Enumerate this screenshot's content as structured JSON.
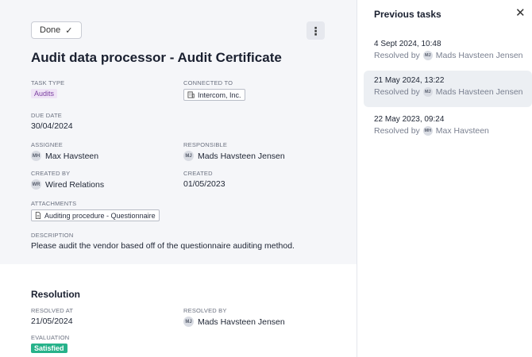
{
  "task": {
    "done_label": "Done",
    "title": "Audit data processor - Audit Certificate",
    "fields": {
      "task_type": {
        "label": "TASK TYPE",
        "value": "Audits"
      },
      "connected_to": {
        "label": "CONNECTED TO",
        "value": "Intercom, Inc."
      },
      "due_date": {
        "label": "DUE DATE",
        "value": "30/04/2024"
      },
      "assignee": {
        "label": "ASSIGNEE",
        "initials": "MH",
        "value": "Max Havsteen"
      },
      "responsible": {
        "label": "RESPONSIBLE",
        "initials": "MJ",
        "value": "Mads Havsteen Jensen"
      },
      "created_by": {
        "label": "CREATED BY",
        "initials": "WR",
        "value": "Wired Relations"
      },
      "created": {
        "label": "CREATED",
        "value": "01/05/2023"
      },
      "attachments": {
        "label": "ATTACHMENTS",
        "value": "Auditing procedure - Questionnaire"
      },
      "description": {
        "label": "DESCRIPTION",
        "value": "Please audit the vendor based off of the questionnaire auditing method."
      }
    }
  },
  "resolution": {
    "title": "Resolution",
    "resolved_at": {
      "label": "RESOLVED AT",
      "value": "21/05/2024"
    },
    "resolved_by": {
      "label": "RESOLVED BY",
      "initials": "MJ",
      "value": "Mads Havsteen Jensen"
    },
    "evaluation": {
      "label": "EVALUATION",
      "value": "Satisfied",
      "color": "#27b28a"
    }
  },
  "sidebar": {
    "title": "Previous tasks",
    "resolved_prefix": "Resolved by",
    "items": [
      {
        "date": "4 Sept 2024, 10:48",
        "initials": "MJ",
        "name": "Mads Havsteen Jensen",
        "active": false
      },
      {
        "date": "21 May 2024, 13:22",
        "initials": "MJ",
        "name": "Mads Havsteen Jensen",
        "active": true
      },
      {
        "date": "22 May 2023, 09:24",
        "initials": "MH",
        "name": "Max Havsteen",
        "active": false
      }
    ]
  },
  "icons": {
    "done": "check-icon",
    "more": "more-vertical-icon",
    "connected": "building-icon",
    "attachment": "document-icon",
    "close": "close-icon"
  }
}
